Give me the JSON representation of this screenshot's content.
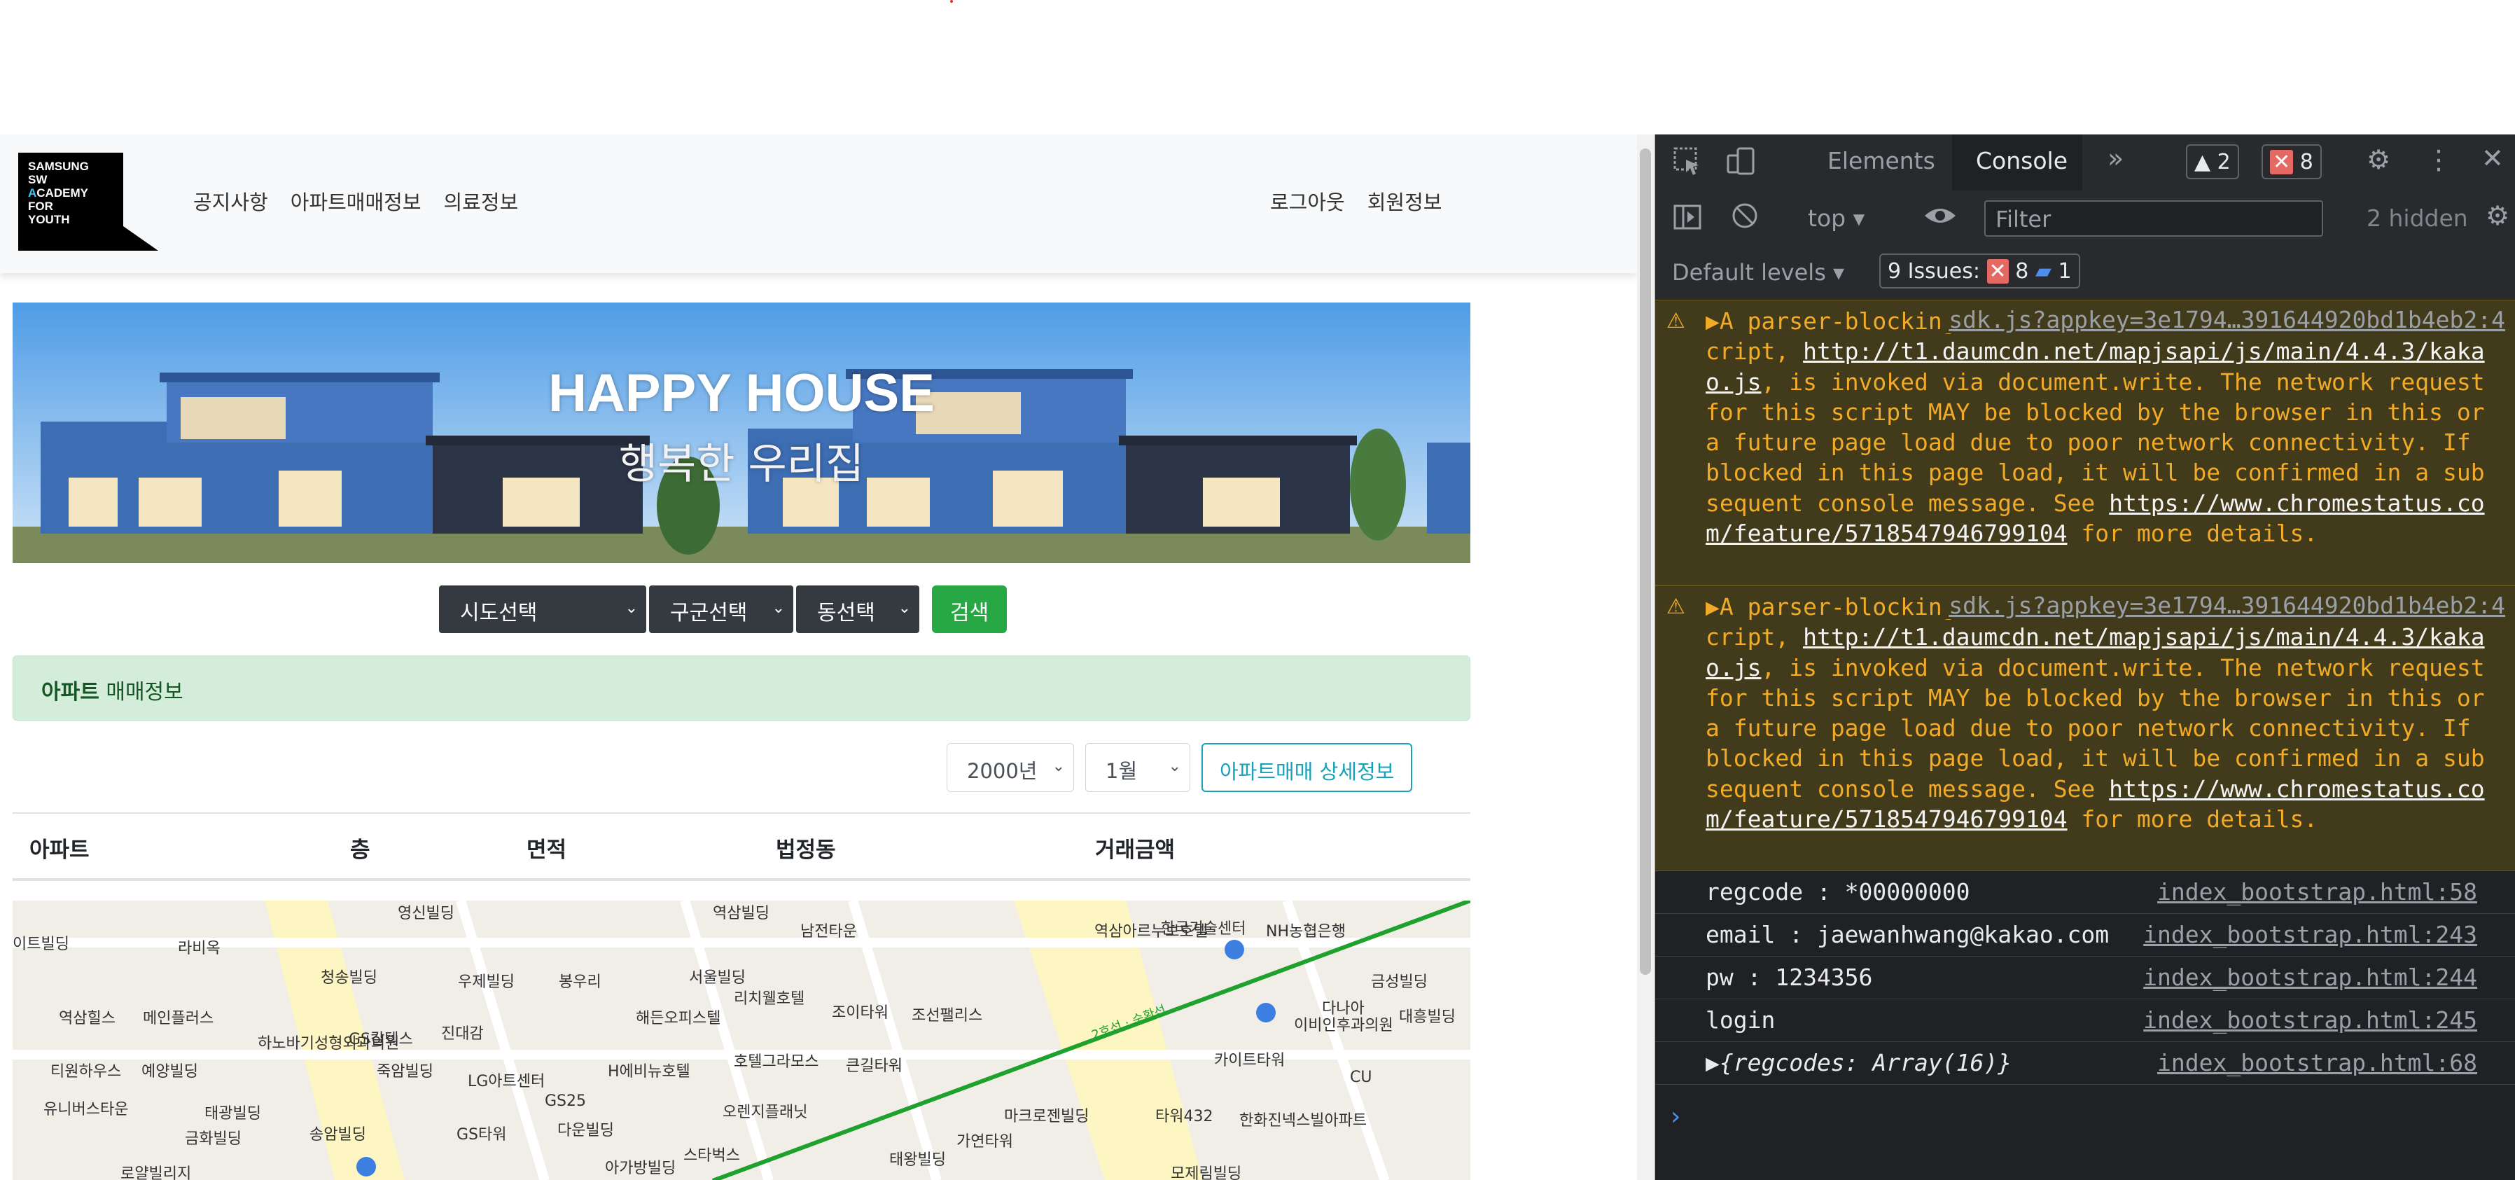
{
  "page": {
    "logo_text": "SAMSUNG\nSW\nACADEMY\nFOR\nYOUTH",
    "nav_left": [
      "공지사항",
      "아파트매매정보",
      "의료정보"
    ],
    "nav_right": [
      "로그아웃",
      "회원정보"
    ],
    "hero_title": "HAPPY HOUSE",
    "hero_subtitle": "행복한 우리집",
    "search": {
      "sido": "시도선택",
      "gugun": "구군선택",
      "dong": "동선택",
      "button": "검색"
    },
    "alert_bold": "아파트",
    "alert_text": "매매정보",
    "filters": {
      "year": "2000년",
      "month": "1월",
      "detail_button": "아파트매매 상세정보"
    },
    "table_headers": [
      "아파트",
      "층",
      "면적",
      "법정동",
      "거래금액"
    ],
    "map_labels": [
      "영신빌딩",
      "역삼빌딩",
      "남전타운",
      "역삼아르누보호텔",
      "한국기술센터",
      "NH농협은행",
      "이트빌딩",
      "라비옥",
      "청송빌딩",
      "우제빌딩",
      "봉우리",
      "서울빌딩",
      "리치웰호텔",
      "조이타워",
      "조선팰리스",
      "금성빌딩",
      "대흥빌딩",
      "다나아",
      "이비인후과의원",
      "역삼힐스",
      "메인플러스",
      "하노바기성형외과의원",
      "GS칼텍스",
      "진대감",
      "해든오피스텔",
      "카이트타워",
      "티원하우스",
      "예양빌딩",
      "죽암빌딩",
      "LG아트센터",
      "H에비뉴호텔",
      "호텔그라모스",
      "큰길타워",
      "CU",
      "유니버스타운",
      "태광빌딩",
      "GS25",
      "오렌지플래닛",
      "마크로젠빌딩",
      "타워432",
      "한화진넥스빌아파트",
      "금화빌딩",
      "송암빌딩",
      "GS타워",
      "다운빌딩",
      "스타벅스",
      "태왕빌딩",
      "가연타워",
      "아가방빌딩",
      "모제림빌딩",
      "로얄빌리지"
    ],
    "map_route_label": "2호선 · 순환선"
  },
  "devtools": {
    "tabs": [
      "Elements",
      "Console"
    ],
    "more_tabs": "»",
    "warnings_count": "2",
    "errors_count": "8",
    "context": "top",
    "filter_placeholder": "Filter",
    "hidden": "2 hidden",
    "levels": "Default levels",
    "issues_label": "9 Issues:",
    "issues_errors": "8",
    "issues_info": "1",
    "messages": [
      {
        "type": "warning",
        "source": "sdk.js?appkey=3e1794…391644920bd1b4eb2:4",
        "text_pre": "A parser-blocking, cross site (i.e. different eTLD+1) script, ",
        "link1": "http://t1.daumcdn.net/mapjsapi/js/main/4.4.3/kakao.js",
        "text_mid": ", is invoked via document.write. The network request for this script MAY be blocked by the browser in this or a future page load due to poor network connectivity. If blocked in this page load, it will be confirmed in a subsequent console message. See ",
        "link2": "https://www.chromestatus.com/feature/5718547946799104",
        "text_post": " for more details."
      },
      {
        "type": "warning",
        "source": "sdk.js?appkey=3e1794…391644920bd1b4eb2:4",
        "text_pre": "A parser-blocking, cross site (i.e. different eTLD+1) script, ",
        "link1": "http://t1.daumcdn.net/mapjsapi/js/main/4.4.3/kakao.js",
        "text_mid": ", is invoked via document.write. The network request for this script MAY be blocked by the browser in this or a future page load due to poor network connectivity. If blocked in this page load, it will be confirmed in a subsequent console message. See ",
        "link2": "https://www.chromestatus.com/feature/5718547946799104",
        "text_post": " for more details."
      }
    ],
    "logs": [
      {
        "text": "regcode : *00000000",
        "source": "index_bootstrap.html:58"
      },
      {
        "text": "email : jaewanhwang@kakao.com",
        "source": "index_bootstrap.html:243"
      },
      {
        "text": "pw : 1234356",
        "source": "index_bootstrap.html:244"
      },
      {
        "text": "login",
        "source": "index_bootstrap.html:245"
      },
      {
        "text": "▶{regcodes: Array(16)}",
        "source": "index_bootstrap.html:68"
      }
    ],
    "prompt": "›"
  }
}
